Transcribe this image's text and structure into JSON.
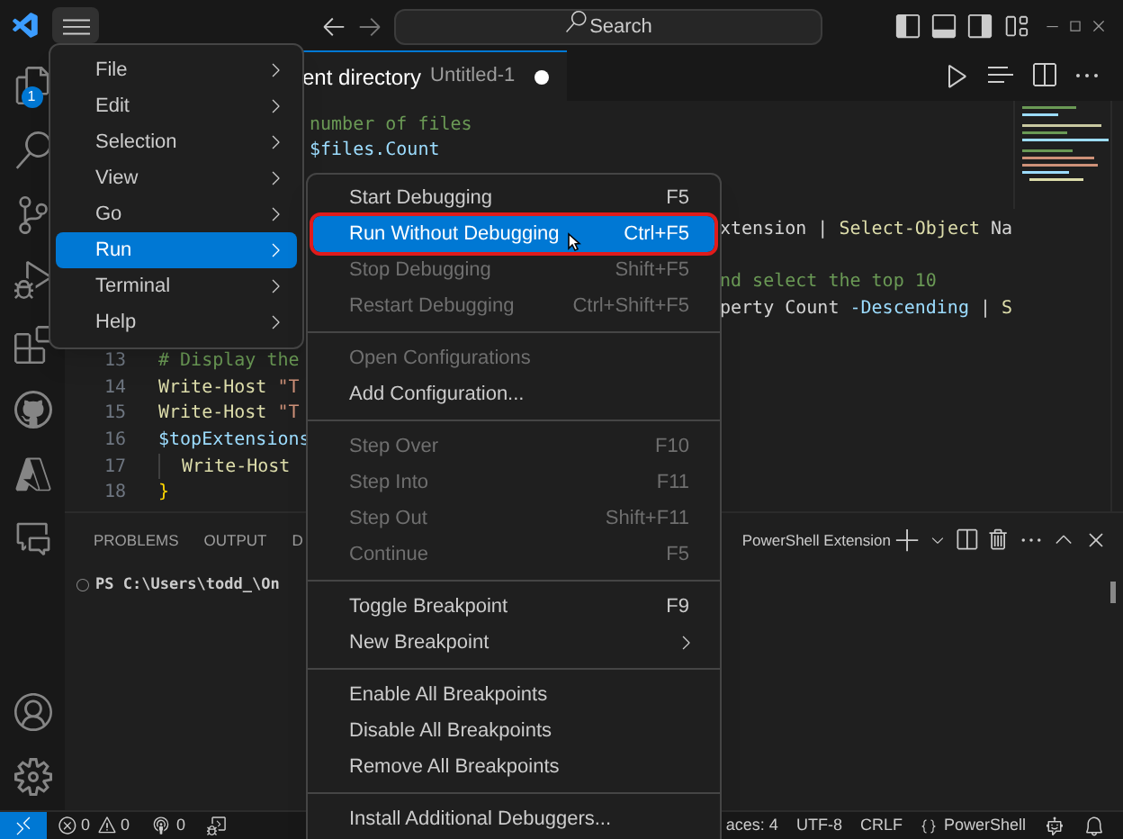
{
  "title_bar": {
    "search": {
      "placeholder": "Search"
    }
  },
  "activity_bar": {
    "explorer_badge": "1"
  },
  "editor": {
    "tab": {
      "folder_text": "ent directory",
      "title": "Untitled-1",
      "dirty": true
    },
    "rows": [
      {
        "kind": "after_menu",
        "tokens": [
          {
            "kind": "comment",
            "text": "number of files"
          }
        ]
      },
      {
        "kind": "after_menu",
        "tokens": [
          {
            "kind": "variable",
            "text": "$files.Count"
          }
        ]
      },
      {
        "kind": "blank"
      },
      {
        "kind": "blank"
      },
      {
        "kind": "after_submenu",
        "tokens": [
          {
            "kind": "plain",
            "text": "xtension | "
          },
          {
            "kind": "command",
            "text": "Select-Object"
          },
          {
            "kind": "plain",
            "text": " Na"
          }
        ]
      },
      {
        "kind": "blank"
      },
      {
        "kind": "after_submenu",
        "tokens": [
          {
            "kind": "comment",
            "text": "nd select the top 10"
          }
        ]
      },
      {
        "kind": "after_submenu",
        "tokens": [
          {
            "kind": "plain",
            "text": "perty Count "
          },
          {
            "kind": "param",
            "text": "-Descending"
          },
          {
            "kind": "plain",
            "text": " | "
          },
          {
            "kind": "command",
            "text": "S"
          }
        ]
      },
      {
        "kind": "blank"
      },
      {
        "kind": "full",
        "number": "13",
        "tokens": [
          {
            "kind": "comment",
            "text": "# Display the"
          }
        ]
      },
      {
        "kind": "full",
        "number": "14",
        "tokens": [
          {
            "kind": "command",
            "text": "Write-Host"
          },
          {
            "kind": "string",
            "gap": true,
            "text": "\"T"
          }
        ]
      },
      {
        "kind": "full",
        "number": "15",
        "tokens": [
          {
            "kind": "command",
            "text": "Write-Host"
          },
          {
            "kind": "string",
            "gap": true,
            "text": "\"T"
          }
        ]
      },
      {
        "kind": "full",
        "number": "16",
        "tokens": [
          {
            "kind": "variable",
            "text": "$topExtensions"
          }
        ]
      },
      {
        "kind": "full",
        "number": "17",
        "indented": true,
        "tokens": [
          {
            "kind": "command",
            "text": "Write-Host"
          }
        ]
      },
      {
        "kind": "full",
        "number": "18",
        "tokens": [
          {
            "kind": "brace",
            "text": "}"
          }
        ]
      }
    ]
  },
  "panel": {
    "tabs": [
      {
        "label": "PROBLEMS",
        "selected": false
      },
      {
        "label": "OUTPUT",
        "selected": false
      },
      {
        "label": "D",
        "selected": false
      }
    ],
    "terminal_name": "PowerShell Extension",
    "terminal_line": "PS C:\\Users\\todd_\\On"
  },
  "status_bar": {
    "errors": "0",
    "warnings": "0",
    "ports": "0",
    "right": [
      "aces: 4",
      "UTF-8",
      "CRLF"
    ],
    "language": "PowerShell"
  },
  "menu": {
    "items": [
      {
        "label": "File",
        "selected": false
      },
      {
        "label": "Edit",
        "selected": false
      },
      {
        "label": "Selection",
        "selected": false
      },
      {
        "label": "View",
        "selected": false
      },
      {
        "label": "Go",
        "selected": false
      },
      {
        "label": "Run",
        "selected": true
      },
      {
        "label": "Terminal",
        "selected": false
      },
      {
        "label": "Help",
        "selected": false
      }
    ]
  },
  "run_menu": {
    "groups": [
      [
        {
          "label": "Start Debugging",
          "shortcut": "F5",
          "disabled": false,
          "selected": false
        },
        {
          "label": "Run Without Debugging",
          "shortcut": "Ctrl+F5",
          "disabled": false,
          "selected": true
        },
        {
          "label": "Stop Debugging",
          "shortcut": "Shift+F5",
          "disabled": true,
          "selected": false
        },
        {
          "label": "Restart Debugging",
          "shortcut": "Ctrl+Shift+F5",
          "disabled": true,
          "selected": false
        }
      ],
      [
        {
          "label": "Open Configurations",
          "disabled": true,
          "selected": false
        },
        {
          "label": "Add Configuration...",
          "disabled": false,
          "selected": false
        }
      ],
      [
        {
          "label": "Step Over",
          "shortcut": "F10",
          "disabled": true,
          "selected": false
        },
        {
          "label": "Step Into",
          "shortcut": "F11",
          "disabled": true,
          "selected": false
        },
        {
          "label": "Step Out",
          "shortcut": "Shift+F11",
          "disabled": true,
          "selected": false
        },
        {
          "label": "Continue",
          "shortcut": "F5",
          "disabled": true,
          "selected": false
        }
      ],
      [
        {
          "label": "Toggle Breakpoint",
          "shortcut": "F9",
          "disabled": false,
          "selected": false
        },
        {
          "label": "New Breakpoint",
          "submenu": true,
          "disabled": false,
          "selected": false
        }
      ],
      [
        {
          "label": "Enable All Breakpoints",
          "disabled": false,
          "selected": false
        },
        {
          "label": "Disable All Breakpoints",
          "disabled": false,
          "selected": false
        },
        {
          "label": "Remove All Breakpoints",
          "disabled": false,
          "selected": false
        }
      ],
      [
        {
          "label": "Install Additional Debuggers...",
          "disabled": false,
          "selected": false
        }
      ]
    ]
  }
}
